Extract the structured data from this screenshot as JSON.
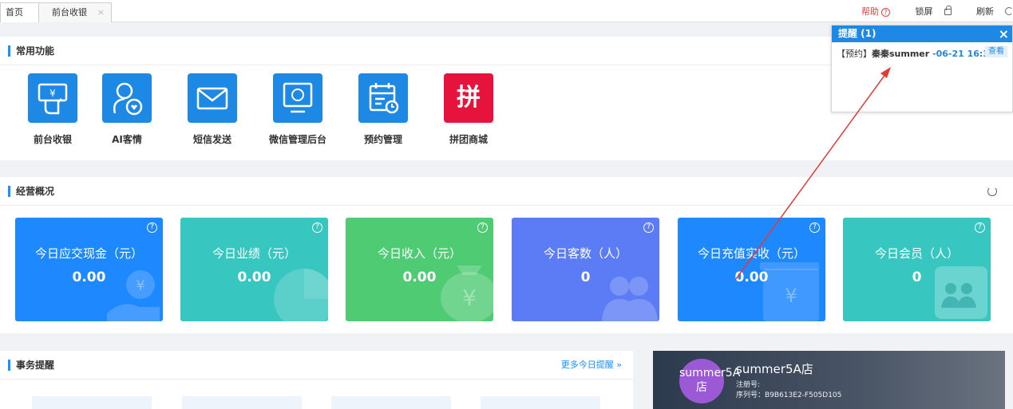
{
  "tabs": [
    {
      "label": "首页"
    },
    {
      "label": "前台收银",
      "close": "×"
    }
  ],
  "top_right": {
    "help": "帮助",
    "help_mark": "?",
    "lock": "锁屏",
    "refresh": "刷新"
  },
  "common": {
    "title": "常用功能",
    "items": [
      {
        "label": "前台收银",
        "icon": "cashier-icon"
      },
      {
        "label": "AI客情",
        "icon": "ai-customer-icon"
      },
      {
        "label": "短信发送",
        "icon": "mail-icon"
      },
      {
        "label": "微信管理后台",
        "icon": "wechat-monitor-icon"
      },
      {
        "label": "预约管理",
        "icon": "calendar-icon"
      },
      {
        "label": "拼团商城",
        "icon_text": "拼"
      }
    ]
  },
  "overview": {
    "title": "经营概况",
    "cards": [
      {
        "title": "今日应交现金（元）",
        "value": "0.00",
        "color": "#1e88ff"
      },
      {
        "title": "今日业绩（元）",
        "value": "0.00",
        "color": "#37c6c0"
      },
      {
        "title": "今日收入（元）",
        "value": "0.00",
        "color": "#4ecb73"
      },
      {
        "title": "今日客数（人）",
        "value": "0",
        "color": "#5b7cf5"
      },
      {
        "title": "今日充值实收（元）",
        "value": "0.00",
        "color": "#1e88ff"
      },
      {
        "title": "今日会员（人）",
        "value": "0",
        "color": "#37c6c0"
      }
    ]
  },
  "affairs": {
    "title": "事务提醒",
    "more": "更多今日提醒 »"
  },
  "store": {
    "avatar_text": "summer5A店",
    "name": "summer5A店",
    "reg_label": "注册号:",
    "serial": "序列号：B9B613E2-F505D105"
  },
  "popup": {
    "title": "提醒 (1)",
    "close": "×",
    "tag": "【预约】",
    "name": "秦秦summer",
    "time": " -06-21 16:30",
    "view": "查看"
  }
}
